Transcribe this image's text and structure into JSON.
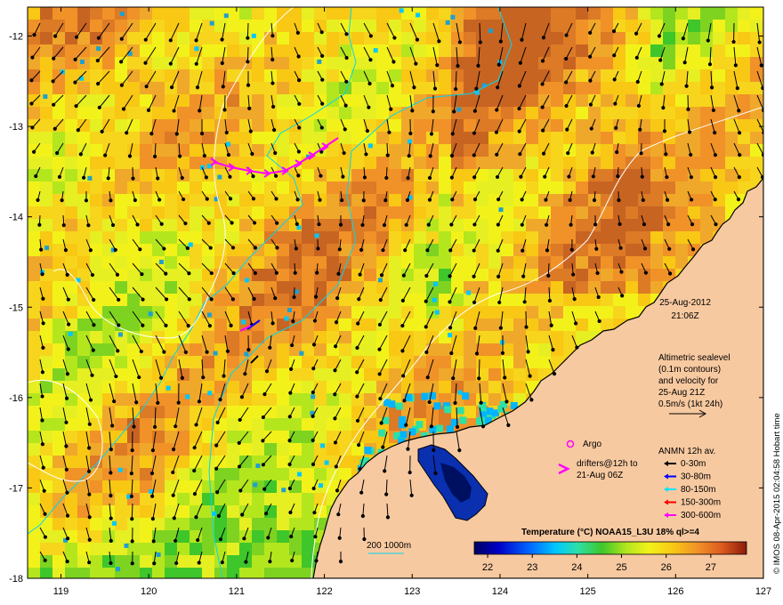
{
  "map": {
    "date": "25-Aug-2012",
    "time": "21:06Z",
    "altimetry_note": [
      "Altimetric sealevel",
      "(0.1m contours)",
      "and velocity for",
      "25-Aug 21Z",
      "0.5m/s (1kt 24h)"
    ],
    "argo_label": "Argo",
    "drifters_label": [
      "drifters@12h to",
      "21-Aug 06Z"
    ],
    "anmn": {
      "title": "ANMN 12h av.",
      "items": [
        {
          "label": "0-30m",
          "color": "#000000"
        },
        {
          "label": "30-80m",
          "color": "#0000ff"
        },
        {
          "label": "80-150m",
          "color": "#00e5ff"
        },
        {
          "label": "150-300m",
          "color": "#ff0000"
        },
        {
          "label": "300-600m",
          "color": "#ff00ff"
        }
      ]
    },
    "bathymetry_label": "200  1000m",
    "colorbar": {
      "title": "Temperature (°C) NOAA15_L3U 18% ql>=4",
      "ticks": [
        "22",
        "23",
        "24",
        "25",
        "26",
        "27"
      ],
      "vmin": 21.7,
      "vmax": 27.8
    },
    "credit": "© IMOS 08-Apr-2015 02:04:58 Hobart time",
    "lon_ticks": [
      "119",
      "120",
      "121",
      "122",
      "123",
      "124",
      "125",
      "126",
      "127"
    ],
    "lat_ticks": [
      "-12",
      "-13",
      "-14",
      "-15",
      "-16",
      "-17",
      "-18"
    ],
    "lon_range": [
      118.62,
      127.0
    ],
    "lat_range": [
      -18.0,
      -11.68
    ],
    "colors": {
      "land": "#f7c9a0",
      "argo": "#ff00ff",
      "drifter": "#ff00ff",
      "sealevel_contour": "#ffffff",
      "isobath": "#00e5ff"
    }
  }
}
